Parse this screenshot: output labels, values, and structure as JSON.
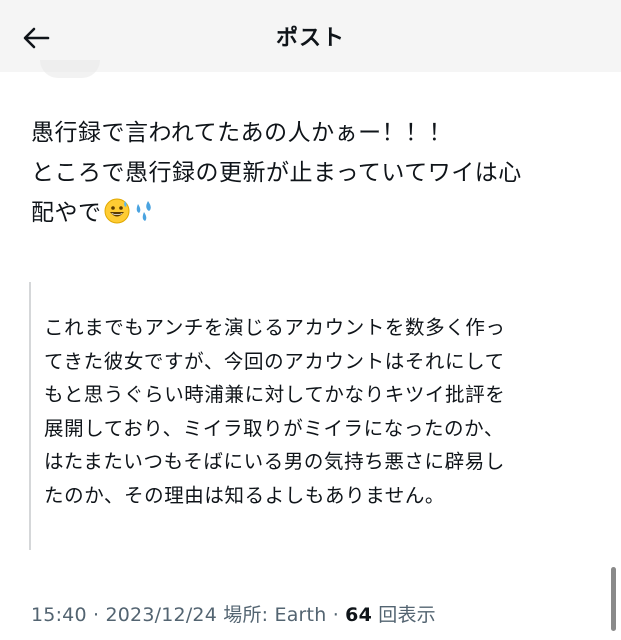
{
  "header": {
    "title": "ポスト"
  },
  "post": {
    "text": "愚行録で言われてたあの人かぁー！！！\nところで愚行録の更新が止まっていてワイは心\n配やで",
    "emojis": [
      "grinning-sweat-emoji",
      "sweat-droplets-emoji"
    ]
  },
  "quote": {
    "text": "これまでもアンチを演じるアカウントを数多く作っ\nてきた彼女ですが、今回のアカウントはそれにして\nもと思うぐらい時浦兼に対してかなりキツイ批評を\n展開しており、ミイラ取りがミイラになったのか、\nはたまたいつもそばにいる男の気持ち悪さに辟易し\nたのか、その理由は知るよしもありません。"
  },
  "meta": {
    "time": "15:40",
    "sep": " · ",
    "date": "2023/12/24",
    "location_prefix": "場所: ",
    "location": "Earth",
    "views": "64",
    "views_suffix": "回表示"
  },
  "colors": {
    "muted": "#536471",
    "text": "#0f1419"
  }
}
